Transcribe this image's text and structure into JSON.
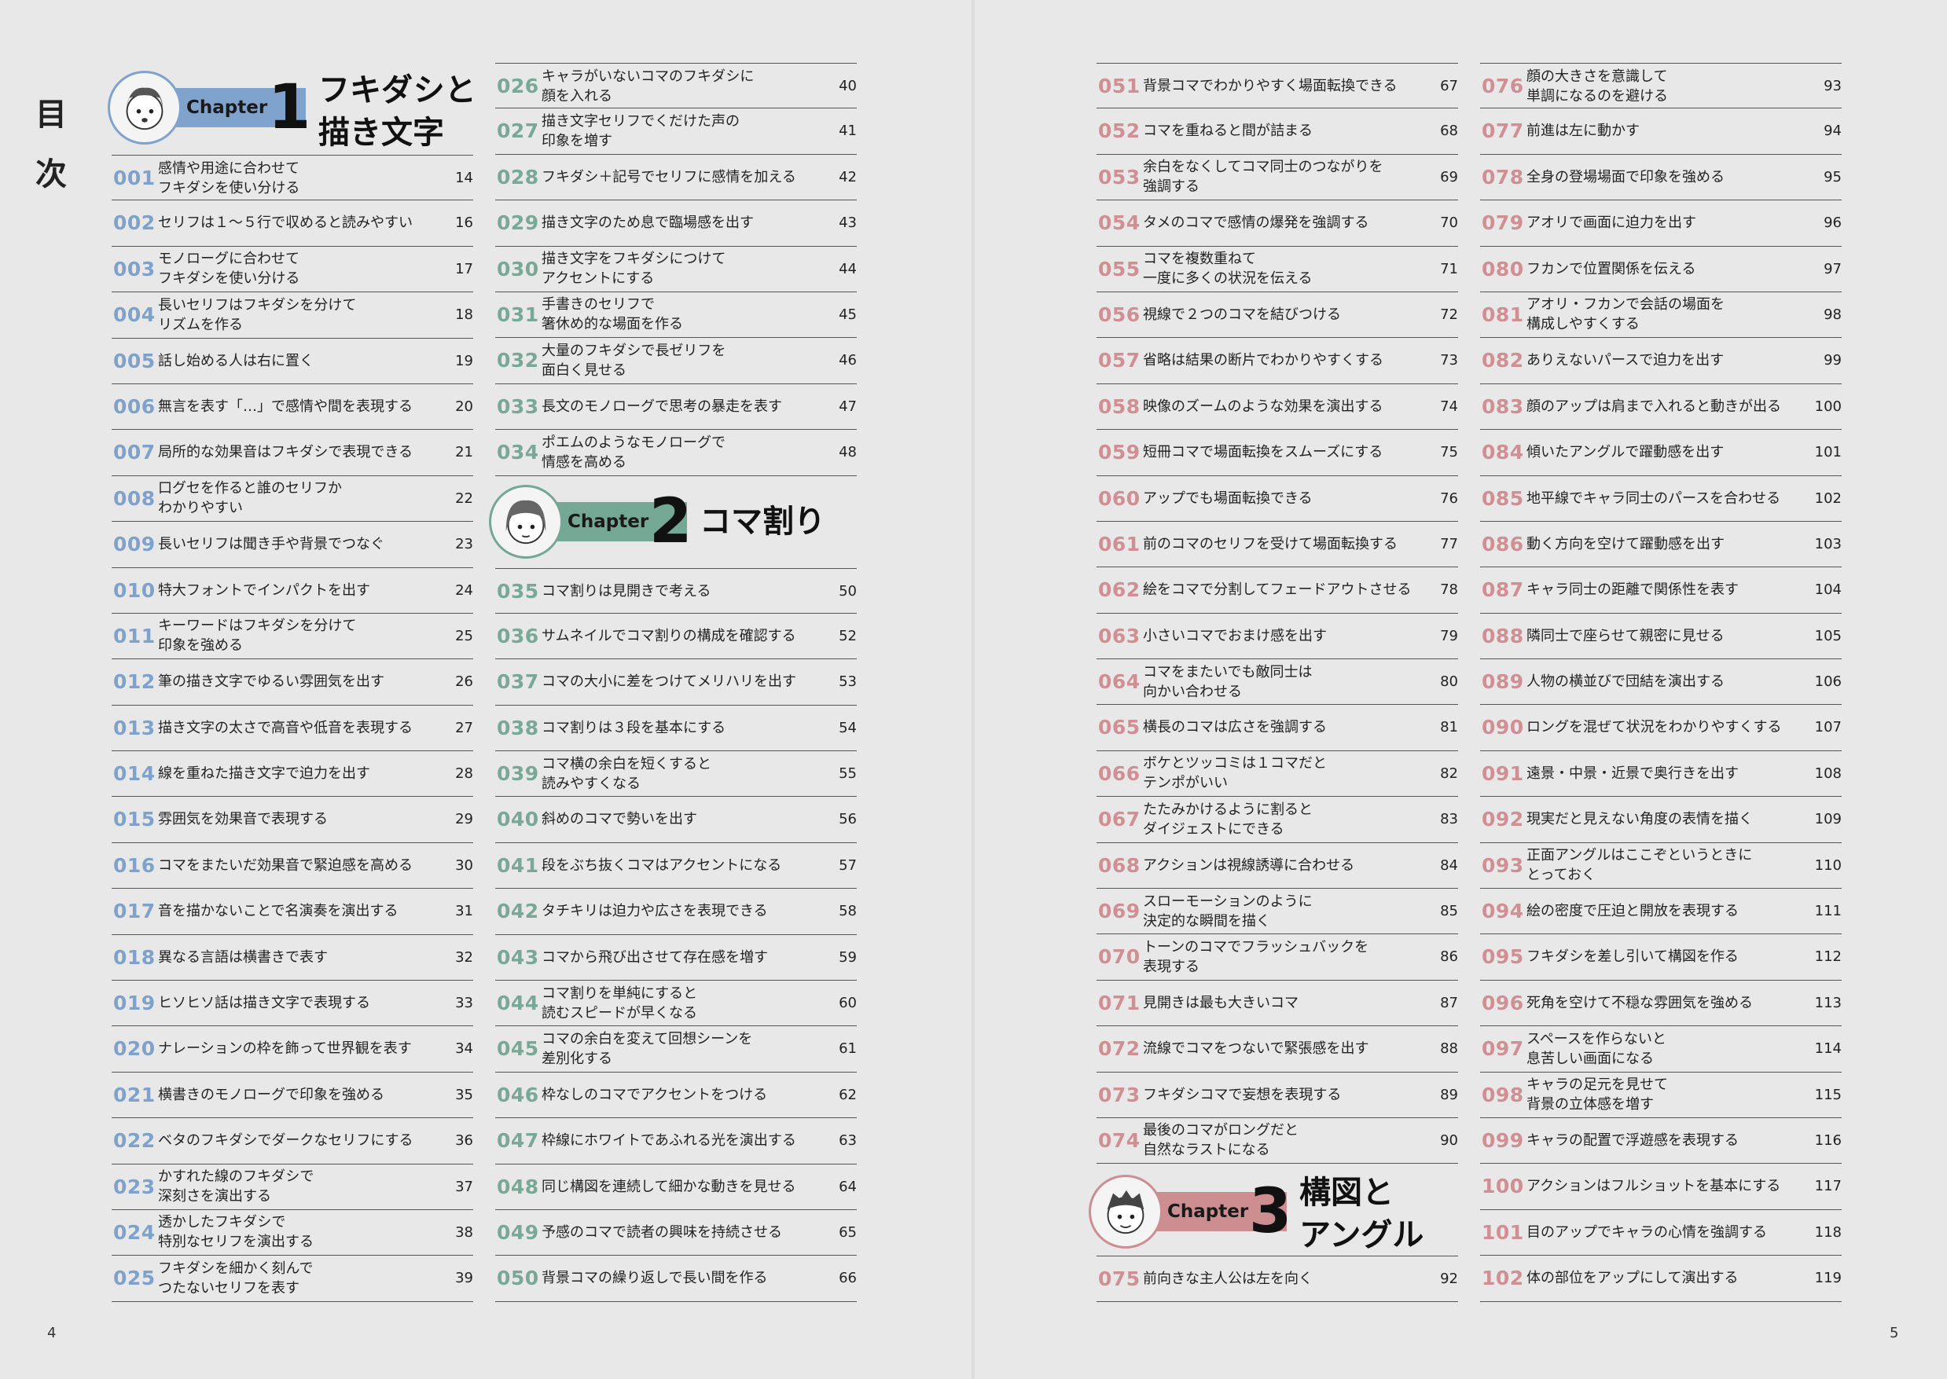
{
  "toc_title": "目\n次",
  "folio_left": "4",
  "folio_right": "5",
  "chapters": [
    {
      "word": "Chapter",
      "number": "1",
      "name": "フキダシと\n描き文字",
      "color": "#7fa3cd"
    },
    {
      "word": "Chapter",
      "number": "2",
      "name": "コマ割り",
      "color": "#74a794"
    },
    {
      "word": "Chapter",
      "number": "3",
      "name": "構図と\nアングル",
      "color": "#cd8e92"
    }
  ],
  "columns": [
    {
      "entries": [
        {
          "num": "001",
          "title": "感情や用途に合わせて\nフキダシを使い分ける",
          "page": "14"
        },
        {
          "num": "002",
          "title": "セリフは１～５行で収めると読みやすい",
          "page": "16"
        },
        {
          "num": "003",
          "title": "モノローグに合わせて\nフキダシを使い分ける",
          "page": "17"
        },
        {
          "num": "004",
          "title": "長いセリフはフキダシを分けて\nリズムを作る",
          "page": "18"
        },
        {
          "num": "005",
          "title": "話し始める人は右に置く",
          "page": "19"
        },
        {
          "num": "006",
          "title": "無言を表す「…」で感情や間を表現する",
          "page": "20"
        },
        {
          "num": "007",
          "title": "局所的な効果音はフキダシで表現できる",
          "page": "21"
        },
        {
          "num": "008",
          "title": "口グセを作ると誰のセリフか\nわかりやすい",
          "page": "22"
        },
        {
          "num": "009",
          "title": "長いセリフは聞き手や背景でつなぐ",
          "page": "23"
        },
        {
          "num": "010",
          "title": "特大フォントでインパクトを出す",
          "page": "24"
        },
        {
          "num": "011",
          "title": "キーワードはフキダシを分けて\n印象を強める",
          "page": "25"
        },
        {
          "num": "012",
          "title": "筆の描き文字でゆるい雰囲気を出す",
          "page": "26"
        },
        {
          "num": "013",
          "title": "描き文字の太さで高音や低音を表現する",
          "page": "27"
        },
        {
          "num": "014",
          "title": "線を重ねた描き文字で迫力を出す",
          "page": "28"
        },
        {
          "num": "015",
          "title": "雰囲気を効果音で表現する",
          "page": "29"
        },
        {
          "num": "016",
          "title": "コマをまたいだ効果音で緊迫感を高める",
          "page": "30"
        },
        {
          "num": "017",
          "title": "音を描かないことで名演奏を演出する",
          "page": "31"
        },
        {
          "num": "018",
          "title": "異なる言語は横書きで表す",
          "page": "32"
        },
        {
          "num": "019",
          "title": "ヒソヒソ話は描き文字で表現する",
          "page": "33"
        },
        {
          "num": "020",
          "title": "ナレーションの枠を飾って世界観を表す",
          "page": "34"
        },
        {
          "num": "021",
          "title": "横書きのモノローグで印象を強める",
          "page": "35"
        },
        {
          "num": "022",
          "title": "ベタのフキダシでダークなセリフにする",
          "page": "36"
        },
        {
          "num": "023",
          "title": "かすれた線のフキダシで\n深刻さを演出する",
          "page": "37"
        },
        {
          "num": "024",
          "title": "透かしたフキダシで\n特別なセリフを演出する",
          "page": "38"
        },
        {
          "num": "025",
          "title": "フキダシを細かく刻んで\nつたないセリフを表す",
          "page": "39"
        }
      ]
    },
    {
      "entries": [
        {
          "num": "026",
          "title": "キャラがいないコマのフキダシに\n顔を入れる",
          "page": "40"
        },
        {
          "num": "027",
          "title": "描き文字セリフでくだけた声の\n印象を増す",
          "page": "41"
        },
        {
          "num": "028",
          "title": "フキダシ＋記号でセリフに感情を加える",
          "page": "42"
        },
        {
          "num": "029",
          "title": "描き文字のため息で臨場感を出す",
          "page": "43"
        },
        {
          "num": "030",
          "title": "描き文字をフキダシにつけて\nアクセントにする",
          "page": "44"
        },
        {
          "num": "031",
          "title": "手書きのセリフで\n箸休め的な場面を作る",
          "page": "45"
        },
        {
          "num": "032",
          "title": "大量のフキダシで長ゼリフを\n面白く見せる",
          "page": "46"
        },
        {
          "num": "033",
          "title": "長文のモノローグで思考の暴走を表す",
          "page": "47"
        },
        {
          "num": "034",
          "title": "ポエムのようなモノローグで\n情感を高める",
          "page": "48"
        },
        {
          "num": "035",
          "title": "コマ割りは見開きで考える",
          "page": "50"
        },
        {
          "num": "036",
          "title": "サムネイルでコマ割りの構成を確認する",
          "page": "52"
        },
        {
          "num": "037",
          "title": "コマの大小に差をつけてメリハリを出す",
          "page": "53"
        },
        {
          "num": "038",
          "title": "コマ割りは３段を基本にする",
          "page": "54"
        },
        {
          "num": "039",
          "title": "コマ横の余白を短くすると\n読みやすくなる",
          "page": "55"
        },
        {
          "num": "040",
          "title": "斜めのコマで勢いを出す",
          "page": "56"
        },
        {
          "num": "041",
          "title": "段をぶち抜くコマはアクセントになる",
          "page": "57"
        },
        {
          "num": "042",
          "title": "タチキリは迫力や広さを表現できる",
          "page": "58"
        },
        {
          "num": "043",
          "title": "コマから飛び出させて存在感を増す",
          "page": "59"
        },
        {
          "num": "044",
          "title": "コマ割りを単純にすると\n読むスピードが早くなる",
          "page": "60"
        },
        {
          "num": "045",
          "title": "コマの余白を変えて回想シーンを\n差別化する",
          "page": "61"
        },
        {
          "num": "046",
          "title": "枠なしのコマでアクセントをつける",
          "page": "62"
        },
        {
          "num": "047",
          "title": "枠線にホワイトであふれる光を演出する",
          "page": "63"
        },
        {
          "num": "048",
          "title": "同じ構図を連続して細かな動きを見せる",
          "page": "64"
        },
        {
          "num": "049",
          "title": "予感のコマで読者の興味を持続させる",
          "page": "65"
        },
        {
          "num": "050",
          "title": "背景コマの繰り返しで長い間を作る",
          "page": "66"
        }
      ]
    },
    {
      "entries": [
        {
          "num": "051",
          "title": "背景コマでわかりやすく場面転換できる",
          "page": "67"
        },
        {
          "num": "052",
          "title": "コマを重ねると間が詰まる",
          "page": "68"
        },
        {
          "num": "053",
          "title": "余白をなくしてコマ同士のつながりを\n強調する",
          "page": "69"
        },
        {
          "num": "054",
          "title": "タメのコマで感情の爆発を強調する",
          "page": "70"
        },
        {
          "num": "055",
          "title": "コマを複数重ねて\n一度に多くの状況を伝える",
          "page": "71"
        },
        {
          "num": "056",
          "title": "視線で２つのコマを結びつける",
          "page": "72"
        },
        {
          "num": "057",
          "title": "省略は結果の断片でわかりやすくする",
          "page": "73"
        },
        {
          "num": "058",
          "title": "映像のズームのような効果を演出する",
          "page": "74"
        },
        {
          "num": "059",
          "title": "短冊コマで場面転換をスムーズにする",
          "page": "75"
        },
        {
          "num": "060",
          "title": "アップでも場面転換できる",
          "page": "76"
        },
        {
          "num": "061",
          "title": "前のコマのセリフを受けて場面転換する",
          "page": "77"
        },
        {
          "num": "062",
          "title": "絵をコマで分割してフェードアウトさせる",
          "page": "78"
        },
        {
          "num": "063",
          "title": "小さいコマでおまけ感を出す",
          "page": "79"
        },
        {
          "num": "064",
          "title": "コマをまたいでも敵同士は\n向かい合わせる",
          "page": "80"
        },
        {
          "num": "065",
          "title": "横長のコマは広さを強調する",
          "page": "81"
        },
        {
          "num": "066",
          "title": "ボケとツッコミは１コマだと\nテンポがいい",
          "page": "82"
        },
        {
          "num": "067",
          "title": "たたみかけるように割ると\nダイジェストにできる",
          "page": "83"
        },
        {
          "num": "068",
          "title": "アクションは視線誘導に合わせる",
          "page": "84"
        },
        {
          "num": "069",
          "title": "スローモーションのように\n決定的な瞬間を描く",
          "page": "85"
        },
        {
          "num": "070",
          "title": "トーンのコマでフラッシュバックを\n表現する",
          "page": "86"
        },
        {
          "num": "071",
          "title": "見開きは最も大きいコマ",
          "page": "87"
        },
        {
          "num": "072",
          "title": "流線でコマをつないで緊張感を出す",
          "page": "88"
        },
        {
          "num": "073",
          "title": "フキダシコマで妄想を表現する",
          "page": "89"
        },
        {
          "num": "074",
          "title": "最後のコマがロングだと\n自然なラストになる",
          "page": "90"
        },
        {
          "num": "075",
          "title": "前向きな主人公は左を向く",
          "page": "92"
        }
      ]
    },
    {
      "entries": [
        {
          "num": "076",
          "title": "顔の大きさを意識して\n単調になるのを避ける",
          "page": "93"
        },
        {
          "num": "077",
          "title": "前進は左に動かす",
          "page": "94"
        },
        {
          "num": "078",
          "title": "全身の登場場面で印象を強める",
          "page": "95"
        },
        {
          "num": "079",
          "title": "アオリで画面に迫力を出す",
          "page": "96"
        },
        {
          "num": "080",
          "title": "フカンで位置関係を伝える",
          "page": "97"
        },
        {
          "num": "081",
          "title": "アオリ・フカンで会話の場面を\n構成しやすくする",
          "page": "98"
        },
        {
          "num": "082",
          "title": "ありえないパースで迫力を出す",
          "page": "99"
        },
        {
          "num": "083",
          "title": "顔のアップは肩まで入れると動きが出る",
          "page": "100"
        },
        {
          "num": "084",
          "title": "傾いたアングルで躍動感を出す",
          "page": "101"
        },
        {
          "num": "085",
          "title": "地平線でキャラ同士のパースを合わせる",
          "page": "102"
        },
        {
          "num": "086",
          "title": "動く方向を空けて躍動感を出す",
          "page": "103"
        },
        {
          "num": "087",
          "title": "キャラ同士の距離で関係性を表す",
          "page": "104"
        },
        {
          "num": "088",
          "title": "隣同士で座らせて親密に見せる",
          "page": "105"
        },
        {
          "num": "089",
          "title": "人物の横並びで団結を演出する",
          "page": "106"
        },
        {
          "num": "090",
          "title": "ロングを混ぜて状況をわかりやすくする",
          "page": "107"
        },
        {
          "num": "091",
          "title": "遠景・中景・近景で奥行きを出す",
          "page": "108"
        },
        {
          "num": "092",
          "title": "現実だと見えない角度の表情を描く",
          "page": "109"
        },
        {
          "num": "093",
          "title": "正面アングルはここぞというときに\nとっておく",
          "page": "110"
        },
        {
          "num": "094",
          "title": "絵の密度で圧迫と開放を表現する",
          "page": "111"
        },
        {
          "num": "095",
          "title": "フキダシを差し引いて構図を作る",
          "page": "112"
        },
        {
          "num": "096",
          "title": "死角を空けて不穏な雰囲気を強める",
          "page": "113"
        },
        {
          "num": "097",
          "title": "スペースを作らないと\n息苦しい画面になる",
          "page": "114"
        },
        {
          "num": "098",
          "title": "キャラの足元を見せて\n背景の立体感を増す",
          "page": "115"
        },
        {
          "num": "099",
          "title": "キャラの配置で浮遊感を表現する",
          "page": "116"
        },
        {
          "num": "100",
          "title": "アクションはフルショットを基本にする",
          "page": "117"
        },
        {
          "num": "101",
          "title": "目のアップでキャラの心情を強調する",
          "page": "118"
        },
        {
          "num": "102",
          "title": "体の部位をアップにして演出する",
          "page": "119"
        }
      ]
    }
  ]
}
